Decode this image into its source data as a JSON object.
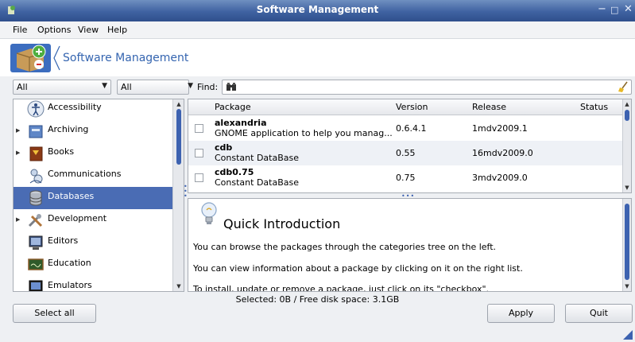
{
  "window": {
    "title": "Software Management",
    "controls": {
      "minimize": "−",
      "maximize": "□",
      "close": "✕"
    }
  },
  "menu": [
    "File",
    "Options",
    "View",
    "Help"
  ],
  "banner": {
    "title": "Software Management"
  },
  "filters": {
    "filter1": "All",
    "filter2": "All",
    "find_label": "Find:",
    "find_value": ""
  },
  "categories": [
    {
      "label": "Accessibility",
      "expandable": false,
      "selected": false,
      "icon": "accessibility-icon"
    },
    {
      "label": "Archiving",
      "expandable": true,
      "selected": false,
      "icon": "archive-icon"
    },
    {
      "label": "Books",
      "expandable": true,
      "selected": false,
      "icon": "book-icon"
    },
    {
      "label": "Communications",
      "expandable": false,
      "selected": false,
      "icon": "communications-icon"
    },
    {
      "label": "Databases",
      "expandable": false,
      "selected": true,
      "icon": "database-icon"
    },
    {
      "label": "Development",
      "expandable": true,
      "selected": false,
      "icon": "tools-icon"
    },
    {
      "label": "Editors",
      "expandable": false,
      "selected": false,
      "icon": "editor-icon"
    },
    {
      "label": "Education",
      "expandable": false,
      "selected": false,
      "icon": "chalkboard-icon"
    },
    {
      "label": "Emulators",
      "expandable": false,
      "selected": false,
      "icon": "monitor-icon"
    }
  ],
  "package_list": {
    "columns": [
      "Package",
      "Version",
      "Release",
      "Status"
    ],
    "rows": [
      {
        "name": "alexandria",
        "description": "GNOME application to help you manag...",
        "version": "0.6.4.1",
        "release": "1mdv2009.1",
        "status": ""
      },
      {
        "name": "cdb",
        "description": "Constant DataBase",
        "version": "0.55",
        "release": "16mdv2009.0",
        "status": ""
      },
      {
        "name": "cdb0.75",
        "description": "Constant DataBase",
        "version": "0.75",
        "release": "3mdv2009.0",
        "status": ""
      }
    ]
  },
  "info": {
    "title": "Quick Introduction",
    "lines": [
      "You can browse the packages through the categories tree on the left.",
      "You can view information about a package by clicking on it on the right list.",
      "To install, update or remove a package, just click on its \"checkbox\"."
    ]
  },
  "status": "Selected: 0B / Free disk space: 3.1GB",
  "buttons": {
    "select_all": "Select all",
    "apply": "Apply",
    "quit": "Quit"
  },
  "colors": {
    "accent": "#4a6cb4",
    "title_blue": "#3565b0",
    "titlebar": "#3f62a1"
  }
}
